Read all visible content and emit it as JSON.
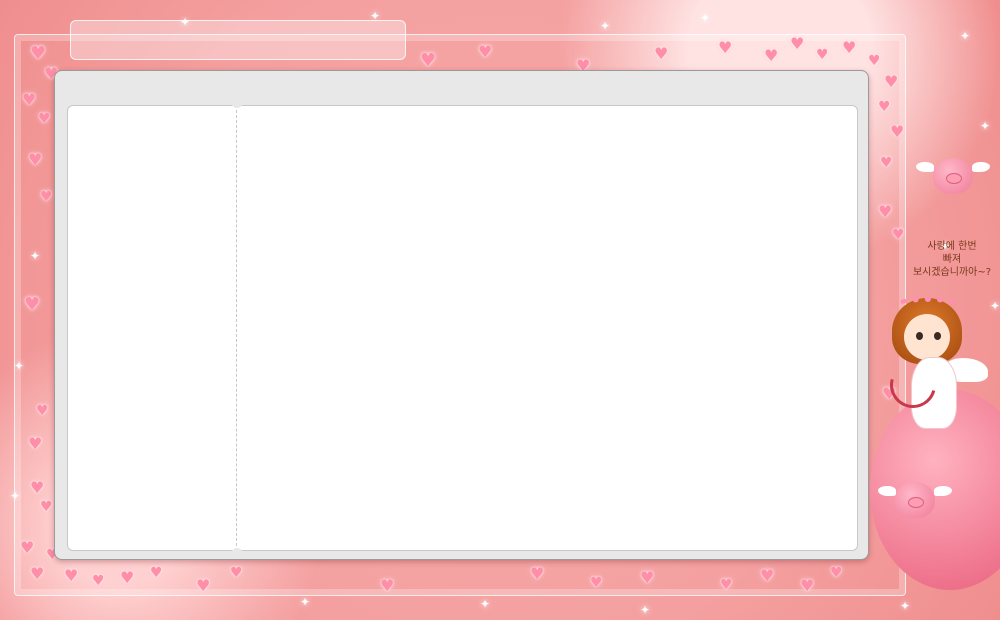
{
  "caption": {
    "line1": "사랑에 한번",
    "line2": "빠져",
    "line3": "보시겠습니까아~?"
  },
  "colors": {
    "background": "#f4a0a0",
    "heart": "#ff8fa8",
    "window": "#e8e8e8",
    "panel": "#ffffff"
  },
  "icons": [
    "heart-icon",
    "sparkle-icon",
    "flying-pig-icon",
    "cupid-illustration"
  ]
}
